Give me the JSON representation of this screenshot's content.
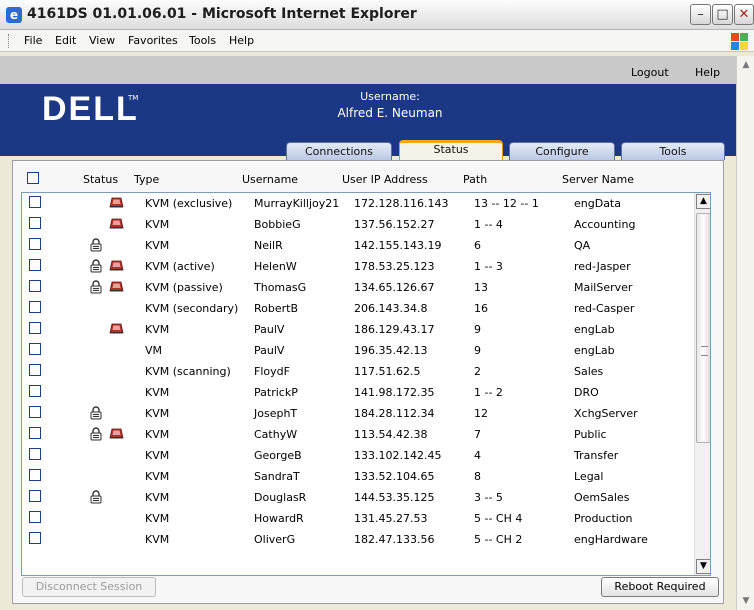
{
  "window": {
    "title": "4161DS 01.01.06.01 - Microsoft Internet Explorer",
    "icon": "ie-icon"
  },
  "menu": [
    "File",
    "Edit",
    "View",
    "Favorites",
    "Tools",
    "Help"
  ],
  "top_links": {
    "logout": "Logout",
    "help": "Help"
  },
  "brand": {
    "logo": "DELL",
    "tm": "TM"
  },
  "user": {
    "label": "Username:",
    "name": "Alfred E. Neuman"
  },
  "tabs": [
    "Connections",
    "Status",
    "Configure",
    "Tools"
  ],
  "active_tab": "Status",
  "columns": [
    "Status",
    "Type",
    "Username",
    "User IP Address",
    "Path",
    "Server Name"
  ],
  "rows": [
    {
      "lock": false,
      "kvm": true,
      "type": "KVM (exclusive)",
      "username": "MurrayKilljoy21",
      "ip": "172.128.116.143",
      "path": "13 -- 12 -- 1",
      "server": "engData"
    },
    {
      "lock": false,
      "kvm": true,
      "type": "KVM",
      "username": "BobbieG",
      "ip": "137.56.152.27",
      "path": "1 -- 4",
      "server": "Accounting"
    },
    {
      "lock": true,
      "kvm": false,
      "type": "KVM",
      "username": "NeilR",
      "ip": "142.155.143.19",
      "path": "6",
      "server": "QA"
    },
    {
      "lock": true,
      "kvm": true,
      "type": "KVM (active)",
      "username": "HelenW",
      "ip": "178.53.25.123",
      "path": "1 -- 3",
      "server": "red-Jasper"
    },
    {
      "lock": true,
      "kvm": true,
      "type": "KVM (passive)",
      "username": "ThomasG",
      "ip": "134.65.126.67",
      "path": "13",
      "server": "MailServer"
    },
    {
      "lock": false,
      "kvm": false,
      "type": "KVM (secondary)",
      "username": "RobertB",
      "ip": "206.143.34.8",
      "path": "16",
      "server": "red-Casper"
    },
    {
      "lock": false,
      "kvm": true,
      "type": "KVM",
      "username": "PaulV",
      "ip": "186.129.43.17",
      "path": "9",
      "server": "engLab"
    },
    {
      "lock": false,
      "kvm": false,
      "type": "VM",
      "username": "PaulV",
      "ip": "196.35.42.13",
      "path": "9",
      "server": "engLab"
    },
    {
      "lock": false,
      "kvm": false,
      "type": "KVM (scanning)",
      "username": "FloydF",
      "ip": "117.51.62.5",
      "path": "2",
      "server": "Sales"
    },
    {
      "lock": false,
      "kvm": false,
      "type": "KVM",
      "username": "PatrickP",
      "ip": "141.98.172.35",
      "path": "1 -- 2",
      "server": "DRO"
    },
    {
      "lock": true,
      "kvm": false,
      "type": "KVM",
      "username": "JosephT",
      "ip": "184.28.112.34",
      "path": "12",
      "server": "XchgServer"
    },
    {
      "lock": true,
      "kvm": true,
      "type": "KVM",
      "username": "CathyW",
      "ip": "113.54.42.38",
      "path": "7",
      "server": "Public"
    },
    {
      "lock": false,
      "kvm": false,
      "type": "KVM",
      "username": "GeorgeB",
      "ip": "133.102.142.45",
      "path": "4",
      "server": "Transfer"
    },
    {
      "lock": false,
      "kvm": false,
      "type": "KVM",
      "username": "SandraT",
      "ip": "133.52.104.65",
      "path": "8",
      "server": "Legal"
    },
    {
      "lock": true,
      "kvm": false,
      "type": "KVM",
      "username": "DouglasR",
      "ip": "144.53.35.125",
      "path": "3 -- 5",
      "server": "OemSales"
    },
    {
      "lock": false,
      "kvm": false,
      "type": "KVM",
      "username": "HowardR",
      "ip": "131.45.27.53",
      "path": "5 -- CH 4",
      "server": "Production"
    },
    {
      "lock": false,
      "kvm": false,
      "type": "KVM",
      "username": "OliverG",
      "ip": "182.47.133.56",
      "path": "5 -- CH 2",
      "server": "engHardware"
    }
  ],
  "buttons": {
    "disconnect": "Disconnect Session",
    "reboot": "Reboot Required"
  },
  "colors": {
    "brand_blue": "#1c3784",
    "tab_active": "#f0a81c",
    "kvm_icon": "#b0302a"
  }
}
